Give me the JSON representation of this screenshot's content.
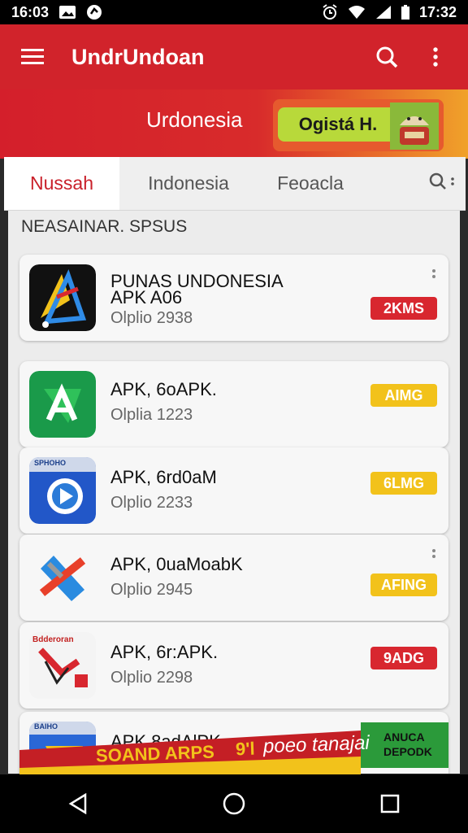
{
  "status_bar": {
    "time_left": "16:03",
    "time_right": "17:32"
  },
  "app_bar": {
    "title": "UndrUndoan"
  },
  "banner": {
    "text": "Urdonesia",
    "promo_label": "Ogistá H."
  },
  "tabs": [
    {
      "label": "Nussah",
      "active": true
    },
    {
      "label": "Indonesia",
      "active": false
    },
    {
      "label": "Feoacla",
      "active": false
    }
  ],
  "search_tab": {
    "icon": "search-icon"
  },
  "section": {
    "title": "NEASAINAR. SPSUS"
  },
  "apps": [
    {
      "title": "PUNAS UNDONESIA",
      "title2": "APK A06",
      "subtitle": "Olplio 2938",
      "badge": "2KMS",
      "badge_color": "#d8272f"
    },
    {
      "title": "APK, 6oAPK.",
      "subtitle": "Olplia 1223",
      "badge": "AIMG",
      "badge_color": "#f2c21b"
    },
    {
      "title": "APK, 6rd0aM",
      "subtitle": "Olplio 2233",
      "badge": "6LMG",
      "badge_color": "#f2c21b"
    },
    {
      "title": "APK, 0uaMoabK",
      "subtitle": "Olplio 2945",
      "badge": "AFING",
      "badge_color": "#f2c21b"
    },
    {
      "title": "APK, 6r:APK.",
      "subtitle": "Olplio 2298",
      "badge": "9ADG",
      "badge_color": "#d8272f"
    },
    {
      "title": "APK.8adAlPK",
      "subtitle": "",
      "badge": "",
      "badge_color": ""
    }
  ],
  "app_icon_labels": {
    "icon3_text": "SPHOHO",
    "icon5_text": "Bdderoran",
    "icon6_text": "BAIHO"
  },
  "promo_strip": {
    "text": "SOAND ARPS",
    "text_mid": "9'l",
    "text_right": "poeo tanajai",
    "green_label_1": "ANUCA",
    "green_label_2": "DEPODK"
  },
  "colors": {
    "accent": "#d1232b",
    "badge_red": "#d8272f",
    "badge_yellow": "#f2c21b",
    "tab_active": "#c9202a"
  }
}
